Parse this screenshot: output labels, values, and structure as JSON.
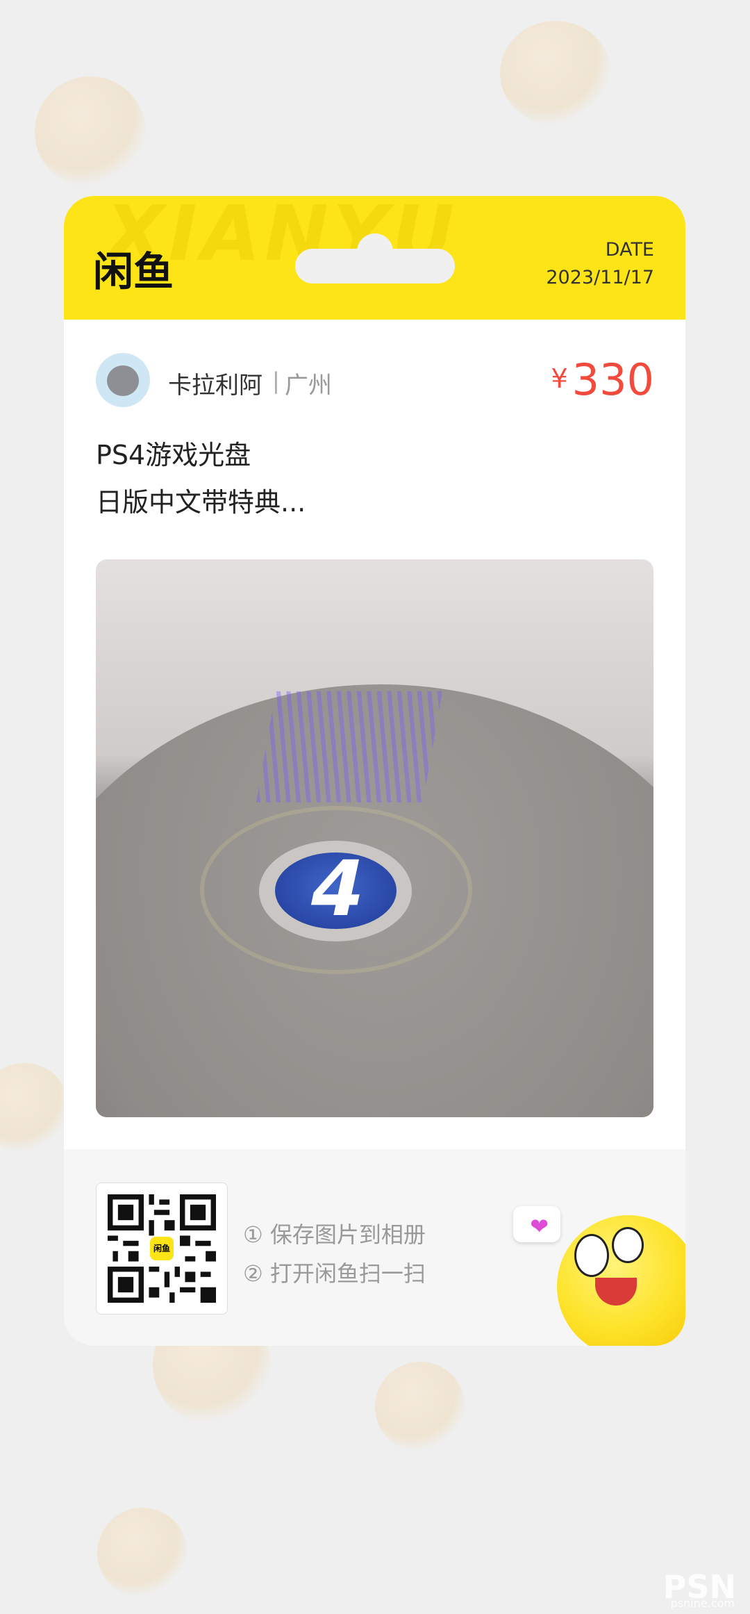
{
  "header": {
    "watermark": "XIANYU",
    "brand": "闲鱼",
    "date_label": "DATE",
    "date_value": "2023/11/17"
  },
  "seller": {
    "name": "卡拉利阿",
    "separator": "|",
    "location": "广州"
  },
  "price": {
    "currency": "¥",
    "value": "330"
  },
  "product": {
    "title_line1": "PS4游戏光盘",
    "title_line2": "日版中文带特典...",
    "disc_label": "4"
  },
  "footer": {
    "qr_badge": "闲鱼",
    "step1": "① 保存图片到相册",
    "step2": "② 打开闲鱼扫一扫"
  },
  "watermark": {
    "brand": "PSN",
    "sub": "psnine.com"
  },
  "colors": {
    "accent_yellow": "#fce417",
    "price_red": "#f24a3d",
    "background": "#efefef"
  }
}
